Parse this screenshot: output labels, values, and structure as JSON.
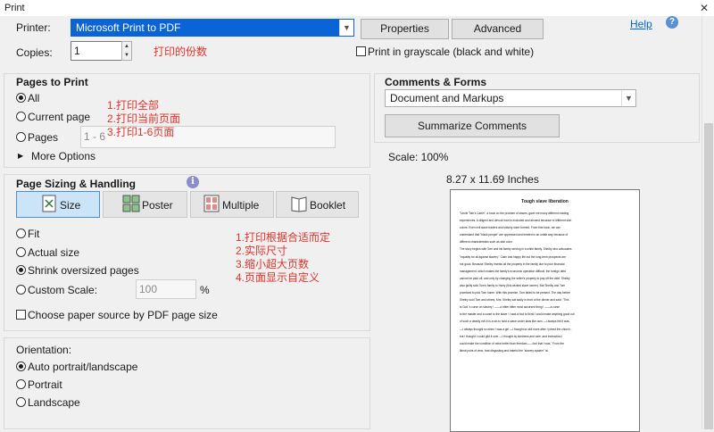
{
  "window": {
    "title": "Print",
    "close_glyph": "✕"
  },
  "printer": {
    "label": "Printer:",
    "selected": "Microsoft Print to PDF",
    "properties_label": "Properties",
    "advanced_label": "Advanced",
    "help_label": "Help"
  },
  "copies": {
    "label": "Copies:",
    "value": "1",
    "annotation": "打印的份数"
  },
  "grayscale": {
    "label": "Print in grayscale (black and white)",
    "checked": false
  },
  "pages_to_print": {
    "heading": "Pages to Print",
    "options": [
      "All",
      "Current page",
      "Pages"
    ],
    "selected": "All",
    "pages_placeholder": "1 - 6",
    "more_options": "More Options",
    "annotations": [
      "1.打印全部",
      "2.打印当前页面",
      "3.打印1-6页面"
    ]
  },
  "page_sizing": {
    "heading": "Page Sizing & Handling",
    "tabs": [
      "Size",
      "Poster",
      "Multiple",
      "Booklet"
    ],
    "active_tab": "Size",
    "options": [
      "Fit",
      "Actual size",
      "Shrink oversized pages",
      "Custom Scale:"
    ],
    "selected": "Shrink oversized pages",
    "custom_scale_value": "100",
    "custom_scale_unit": "%",
    "paper_source_label": "Choose paper source by PDF page size",
    "annotations": [
      "1.打印根据合适而定",
      "2.实际尺寸",
      "3.缩小超大页数",
      "4.页面显示自定义"
    ]
  },
  "orientation": {
    "heading": "Orientation:",
    "options": [
      "Auto portrait/landscape",
      "Portrait",
      "Landscape"
    ],
    "selected": "Auto portrait/landscape"
  },
  "comments_forms": {
    "heading": "Comments & Forms",
    "selected": "Document and Markups",
    "summarize_label": "Summarize Comments"
  },
  "preview": {
    "scale": "Scale: 100%",
    "page_size": "8.27 x 11.69 Inches",
    "doc_title": "Tough slave liberation",
    "lines": [
      "\"Uncle Tom's Cabin\", a book on the problem of slaves, gave me many different reading",
      "experiences. A diligent and devout man is excluded and abused because of different skin",
      "colors. Even evil slave traders and slavery were formed. From this book, we can",
      "understand that \"black people\" are oppressed and treated in an unfair way because of",
      "different characteristics such as skin color.",
      "The story begins with Tom and his family serving in a white family. Shelby who advocates",
      "\"equality for all against slavery.\" Calm and happy life but the long-term prospects are",
      "not good. Because Shelby invests all the property in the family due to poor financial",
      "management, which makes the family's economic operation difficult, the foreign debt",
      "cannot be paid off, and only by changing the seller's property to pay off the debt. Shelby",
      "also guilty sold Tom's family to Harry (this wicked slave owner). But Shelby and Tom",
      "promised to pick Tom home. With this promise, Tom failed to be present. The day before",
      "Shelby sold Tom and others, Mrs. Shelby sat sadly in front of the dinner and said: \"This",
      "is God 's curse on slavery ! ——a bitter   bitter   most accursed thing ! ——a curse",
      "to the master and a curse to the slave ! I was a fool to think I could make anything good out",
      "of such a deadly evil.It is a sin to hold a slave under laws like ours   —I always felt it was,",
      "—I always thought so when I was a girl   —I thought so still more after I joined the church ;",
      "but I thought I could gild it over   —I thought by kindness,and care ,and instruction,I",
      "could make the condition of mine better than freedom——fool that I was,\"   From the",
      "literal point of view, how disgusting and hateful the \"slavery system\" is!"
    ]
  },
  "icons": {
    "help": "help-icon",
    "info": "info-icon",
    "size": "size-icon",
    "poster": "poster-icon",
    "multiple": "multiple-icon",
    "booklet": "booklet-icon",
    "triangle": "▶"
  },
  "colors": {
    "accent": "#0a64d6",
    "annotation": "#e0332b",
    "link": "#0066cc",
    "active_tab": "#cce4f7"
  }
}
